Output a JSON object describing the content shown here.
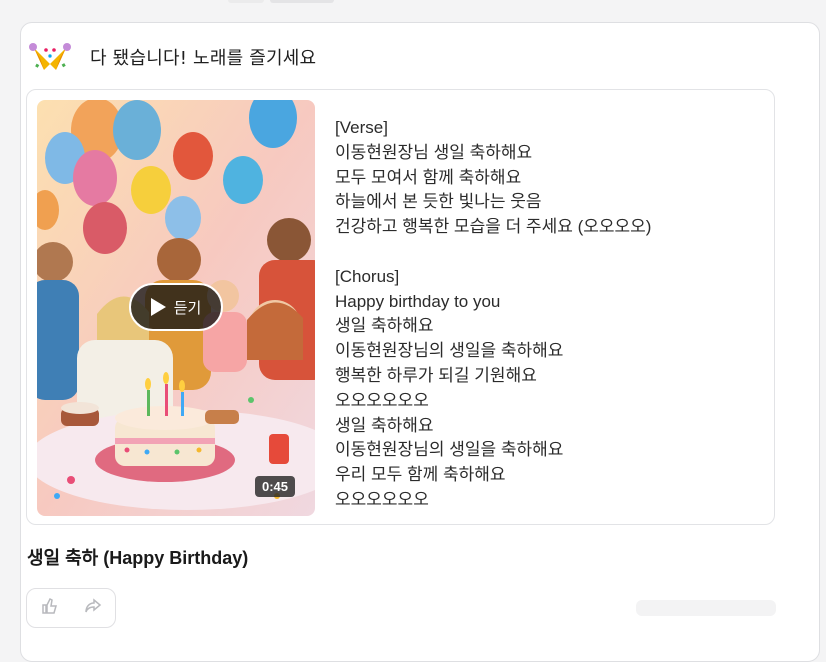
{
  "header": {
    "icon": "party-popper-icon",
    "message": "다 됐습니다! 노래를 즐기세요"
  },
  "player": {
    "play_label": "듣기",
    "duration": "0:45"
  },
  "lyrics": [
    "[Verse]",
    "이동현원장님 생일 축하해요",
    "모두 모여서 함께 축하해요",
    "하늘에서 본 듯한 빛나는 웃음",
    "건강하고 행복한 모습을 더 주세요 (오오오오)",
    "",
    "[Chorus]",
    "Happy birthday to you",
    "생일 축하해요",
    "이동현원장님의 생일을 축하해요",
    "행복한 하루가 되길 기원해요",
    "오오오오오오",
    "생일 축하해요",
    "이동현원장님의 생일을 축하해요",
    "우리 모두 함께 축하해요",
    "오오오오오오"
  ],
  "song": {
    "title": "생일 축하 (Happy Birthday)"
  },
  "actions": [
    {
      "icon": "like-icon"
    },
    {
      "icon": "share-icon"
    }
  ],
  "colors": {
    "accent_dark": "#1a1a1a",
    "card_border": "#dedfe2"
  }
}
